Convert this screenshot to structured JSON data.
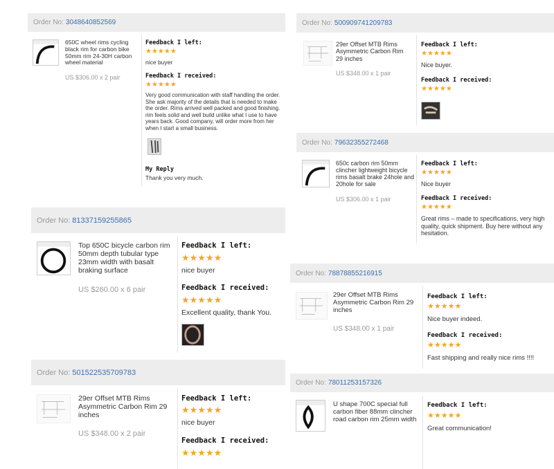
{
  "labels": {
    "order_no": "Order No:",
    "feedback_left": "Feedback I left:",
    "feedback_received": "Feedback I received:",
    "my_reply": "My Reply",
    "stars": "★★★★★"
  },
  "orders": [
    {
      "number": "3048640852569",
      "product": "650C wheel rims cycling black rim for carbon bike 50mm rim 24-30H carbon wheel material",
      "price": "US $306.00 x 2 pair",
      "left_rating": 5,
      "left_comment": "nice buyer",
      "received_rating": 5,
      "received_comment": "Very good communication with staff handling the order. She ask majority of the details that is needed to make the order. Rims arrived well packed and good finishing. rim feels solid and well build unlike what I use to have years back. Good company, will order more from her when I start a small business.",
      "reply": "Thank you very much."
    },
    {
      "number": "81337159255865",
      "product": "Top 650C bicycle carbon rim 50mm depth tubular type 23mm width with basalt braking surface",
      "price": "US $260.00 x 6 pair",
      "left_rating": 5,
      "left_comment": "nice buyer",
      "received_rating": 5,
      "received_comment": "Excellent quality, thank You."
    },
    {
      "number": "501522535709783",
      "product": "29er Offset MTB Rims Asymmetric Carbon Rim 29 inches",
      "price": "US $348.00 x 2 pair",
      "left_rating": 5,
      "left_comment": "nice buyer",
      "received_rating": 5,
      "received_comment": ""
    },
    {
      "number": "500909741209783",
      "product": "29er Offset MTB Rims Asymmetric Carbon Rim 29 inches",
      "price": "US $348.00 x 1 pair",
      "left_rating": 5,
      "left_comment": "Nice buyer.",
      "received_rating": 5,
      "received_comment": ""
    },
    {
      "number": "79632355272468",
      "product": "650c carbon rim 50mm clincher lightweight bicycle rims basalt brake 24hole and 20hole for sale",
      "price": "US $306.00 x 1 pair",
      "left_rating": 5,
      "left_comment": "Nice buyer",
      "received_rating": 5,
      "received_comment": "Great rims – made to specifications, very high quality, quick shipment. Buy here without any hesitation."
    },
    {
      "number": "78878855216915",
      "product": "29er Offset MTB Rims Asymmetric Carbon Rim 29 inches",
      "price": "US $348.00 x 1 pair",
      "left_rating": 5,
      "left_comment": "Nice buyer indeed.",
      "received_rating": 5,
      "received_comment": "Fast shipping and really nice rims !!!!"
    },
    {
      "number": "78011253157326",
      "product": "U shape 700C special full carbon fiber 88mm clincher road carbon rim 25mm width",
      "price": "",
      "left_rating": 5,
      "left_comment": "Great communication!",
      "received_rating": null,
      "received_comment": ""
    }
  ],
  "colors": {
    "star": "#f5a623",
    "order_link": "#3a6fb0",
    "header_bg": "#ededed"
  }
}
